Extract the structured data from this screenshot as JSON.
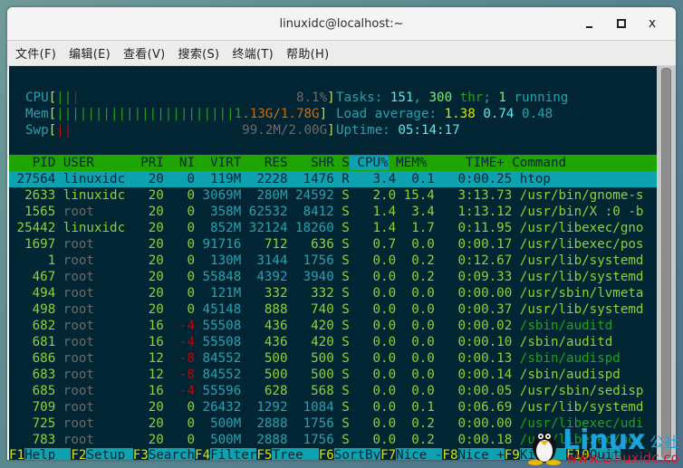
{
  "window": {
    "title": "linuxidc@localhost:~",
    "controls": {
      "minimize": "minimize",
      "maximize": "maximize",
      "close": "x"
    }
  },
  "menubar": [
    "文件(F)",
    "编辑(E)",
    "查看(V)",
    "搜索(S)",
    "终端(T)",
    "帮助(H)"
  ],
  "meters": {
    "cpu": {
      "label": "CPU",
      "bars_green": 2,
      "bars_red": 1,
      "value": "8.1%"
    },
    "mem": {
      "label": "Mem",
      "bars": 23,
      "used": "1.13G",
      "total": "1.78G"
    },
    "swp": {
      "label": "Swp",
      "bars_red": 2,
      "value": "99.2M/2.00G"
    }
  },
  "summary": {
    "tasks_label": "Tasks:",
    "tasks": "151",
    "sep1": ",",
    "threads": "300",
    "thr_label": "thr",
    "sep2": ";",
    "running": "1",
    "running_label": "running",
    "load_label": "Load average:",
    "load1": "1.38",
    "load5": "0.74",
    "load15": "0.48",
    "uptime_label": "Uptime:",
    "uptime": "05:14:17"
  },
  "columns": [
    "PID",
    "USER",
    "PRI",
    "NI",
    "VIRT",
    "RES",
    "SHR",
    "S",
    "CPU%",
    "MEM%",
    "TIME+",
    "Command"
  ],
  "sort_column": "CPU%",
  "processes": [
    {
      "pid": "27564",
      "user": "linuxidc",
      "pri": "20",
      "ni": "0",
      "virt": "119M",
      "res": "2228",
      "shr": "1476",
      "s": "R",
      "cpu": "3.4",
      "mem": "0.1",
      "time": "0:00.25",
      "cmd": "htop",
      "selected": true
    },
    {
      "pid": "2633",
      "user": "linuxidc",
      "pri": "20",
      "ni": "0",
      "virt": "3069M",
      "res": "280M",
      "shr": "24592",
      "s": "S",
      "cpu": "2.0",
      "mem": "15.4",
      "time": "3:13.73",
      "cmd": "/usr/bin/gnome-s"
    },
    {
      "pid": "1565",
      "user": "root",
      "pri": "20",
      "ni": "0",
      "virt": "358M",
      "res": "62532",
      "shr": "8412",
      "s": "S",
      "cpu": "1.4",
      "mem": "3.4",
      "time": "1:13.12",
      "cmd": "/usr/bin/X :0 -b"
    },
    {
      "pid": "25442",
      "user": "linuxidc",
      "pri": "20",
      "ni": "0",
      "virt": "852M",
      "res": "32124",
      "shr": "18260",
      "s": "S",
      "cpu": "1.4",
      "mem": "1.7",
      "time": "0:11.95",
      "cmd": "/usr/libexec/gno"
    },
    {
      "pid": "1697",
      "user": "root",
      "pri": "20",
      "ni": "0",
      "virt": "91716",
      "res": "712",
      "shr": "636",
      "s": "S",
      "cpu": "0.7",
      "mem": "0.0",
      "time": "0:00.17",
      "cmd": "/usr/libexec/pos"
    },
    {
      "pid": "1",
      "user": "root",
      "pri": "20",
      "ni": "0",
      "virt": "130M",
      "res": "3144",
      "shr": "1756",
      "s": "S",
      "cpu": "0.0",
      "mem": "0.2",
      "time": "0:12.67",
      "cmd": "/usr/lib/systemd"
    },
    {
      "pid": "467",
      "user": "root",
      "pri": "20",
      "ni": "0",
      "virt": "55848",
      "res": "4392",
      "shr": "3940",
      "s": "S",
      "cpu": "0.0",
      "mem": "0.2",
      "time": "0:09.33",
      "cmd": "/usr/lib/systemd"
    },
    {
      "pid": "494",
      "user": "root",
      "pri": "20",
      "ni": "0",
      "virt": "121M",
      "res": "332",
      "shr": "332",
      "s": "S",
      "cpu": "0.0",
      "mem": "0.0",
      "time": "0:00.00",
      "cmd": "/usr/sbin/lvmeta"
    },
    {
      "pid": "498",
      "user": "root",
      "pri": "20",
      "ni": "0",
      "virt": "45148",
      "res": "888",
      "shr": "740",
      "s": "S",
      "cpu": "0.0",
      "mem": "0.0",
      "time": "0:00.37",
      "cmd": "/usr/lib/systemd"
    },
    {
      "pid": "682",
      "user": "root",
      "pri": "16",
      "ni": "-4",
      "virt": "55508",
      "res": "436",
      "shr": "420",
      "s": "S",
      "cpu": "0.0",
      "mem": "0.0",
      "time": "0:00.02",
      "cmd": "/sbin/auditd",
      "thread": true
    },
    {
      "pid": "681",
      "user": "root",
      "pri": "16",
      "ni": "-4",
      "virt": "55508",
      "res": "436",
      "shr": "420",
      "s": "S",
      "cpu": "0.0",
      "mem": "0.0",
      "time": "0:00.10",
      "cmd": "/sbin/auditd"
    },
    {
      "pid": "686",
      "user": "root",
      "pri": "12",
      "ni": "-8",
      "virt": "84552",
      "res": "500",
      "shr": "500",
      "s": "S",
      "cpu": "0.0",
      "mem": "0.0",
      "time": "0:00.13",
      "cmd": "/sbin/audispd",
      "thread": true
    },
    {
      "pid": "683",
      "user": "root",
      "pri": "12",
      "ni": "-8",
      "virt": "84552",
      "res": "500",
      "shr": "500",
      "s": "S",
      "cpu": "0.0",
      "mem": "0.0",
      "time": "0:00.14",
      "cmd": "/sbin/audispd"
    },
    {
      "pid": "685",
      "user": "root",
      "pri": "16",
      "ni": "-4",
      "virt": "55596",
      "res": "628",
      "shr": "568",
      "s": "S",
      "cpu": "0.0",
      "mem": "0.0",
      "time": "0:00.05",
      "cmd": "/usr/sbin/sedisp"
    },
    {
      "pid": "709",
      "user": "root",
      "pri": "20",
      "ni": "0",
      "virt": "26432",
      "res": "1292",
      "shr": "1084",
      "s": "S",
      "cpu": "0.0",
      "mem": "0.1",
      "time": "0:06.69",
      "cmd": "/usr/lib/systemd"
    },
    {
      "pid": "725",
      "user": "root",
      "pri": "20",
      "ni": "0",
      "virt": "500M",
      "res": "2888",
      "shr": "1756",
      "s": "S",
      "cpu": "0.0",
      "mem": "0.2",
      "time": "0:00.00",
      "cmd": "/usr/libexec/udi",
      "thread": true
    },
    {
      "pid": "783",
      "user": "root",
      "pri": "20",
      "ni": "0",
      "virt": "500M",
      "res": "2888",
      "shr": "1756",
      "s": "S",
      "cpu": "0.0",
      "mem": "0.2",
      "time": "0:00.18",
      "cmd": "/usr/libexec/udi",
      "thread": true
    }
  ],
  "function_keys": [
    {
      "key": "F1",
      "label": "Help  "
    },
    {
      "key": "F2",
      "label": "Setup "
    },
    {
      "key": "F3",
      "label": "Search"
    },
    {
      "key": "F4",
      "label": "Filter"
    },
    {
      "key": "F5",
      "label": "Tree  "
    },
    {
      "key": "F6",
      "label": "SortBy"
    },
    {
      "key": "F7",
      "label": "Nice -"
    },
    {
      "key": "F8",
      "label": "Nice +"
    },
    {
      "key": "F9",
      "label": "Kill  "
    },
    {
      "key": "F10",
      "label": "Quit"
    }
  ],
  "watermark": {
    "brand": "Linux",
    "brand_cn": "公社",
    "url": "www.Linuxidc.com"
  },
  "colors": {
    "terminal_bg": "#012533",
    "header_bg": "#1fa500",
    "selection_bg": "#0ea2b0"
  }
}
